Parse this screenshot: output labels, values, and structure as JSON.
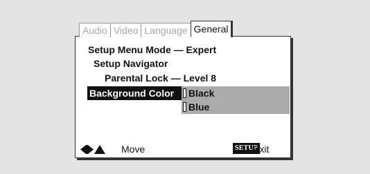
{
  "tabs": [
    {
      "label": "Audio"
    },
    {
      "label": "Video"
    },
    {
      "label": "Language"
    },
    {
      "label": "General"
    }
  ],
  "menu": {
    "line1": "Setup Menu Mode — Expert",
    "line2": "Setup Navigator",
    "line3": "Parental Lock — Level 8",
    "selected": "Background Color"
  },
  "options": [
    {
      "label": "Black"
    },
    {
      "label": "Blue"
    }
  ],
  "footer": {
    "move_label": "Move",
    "setup_badge": "SETUP",
    "exit_label": "Exit"
  }
}
